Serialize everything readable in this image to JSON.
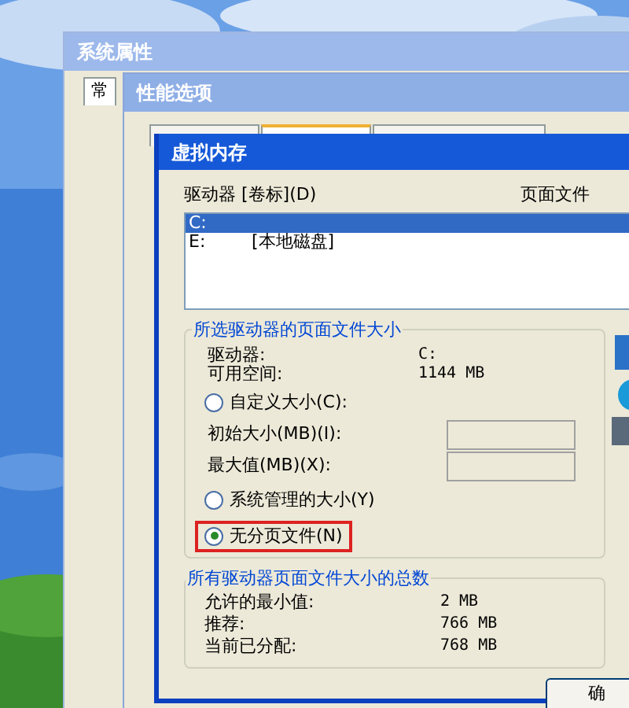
{
  "system_properties": {
    "title": "系统属性",
    "tabs": [
      {
        "label": "常",
        "selected": true
      }
    ]
  },
  "performance_options": {
    "title": "性能选项",
    "tabs": [
      {
        "selected": false
      },
      {
        "selected": true
      },
      {
        "selected": false
      }
    ]
  },
  "virtual_memory": {
    "title": "虚拟内存",
    "list_header": {
      "drive": "驱动器 [卷标](D)",
      "page_file": "页面文件"
    },
    "drives": [
      {
        "letter": "C:",
        "selected": true
      },
      {
        "letter": "E:",
        "label": "[本地磁盘]",
        "selected": false
      }
    ],
    "selected_drive": {
      "heading": "所选驱动器的页面文件大小",
      "info": [
        {
          "label": "驱动器:",
          "value": "C:"
        },
        {
          "label": "可用空间:",
          "value": "1144 MB"
        }
      ],
      "options": [
        {
          "kind": "radio",
          "label": "自定义大小(C):",
          "selected": false,
          "highlighted": false
        },
        {
          "kind": "field",
          "label": "初始大小(MB)(I):",
          "disabled": true
        },
        {
          "kind": "field",
          "label": "最大值(MB)(X):",
          "disabled": true
        },
        {
          "kind": "radio",
          "label": "系统管理的大小(Y)",
          "selected": false,
          "highlighted": false
        },
        {
          "kind": "radio",
          "label": "无分页文件(N)",
          "selected": true,
          "highlighted": true
        }
      ]
    },
    "totals": {
      "heading": "所有驱动器页面文件大小的总数",
      "rows": [
        {
          "label": "允许的最小值:",
          "value": "2 MB"
        },
        {
          "label": "推荐:",
          "value": "766 MB"
        },
        {
          "label": "当前已分配:",
          "value": "768 MB"
        }
      ]
    },
    "buttons": [
      "确"
    ]
  }
}
